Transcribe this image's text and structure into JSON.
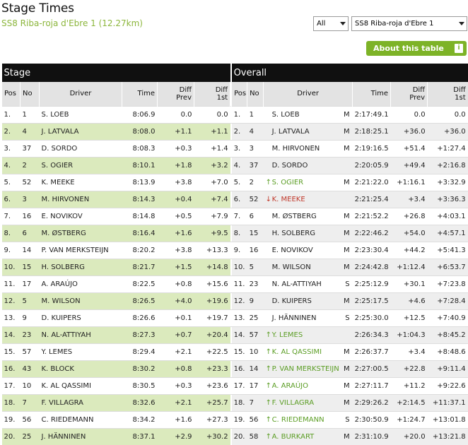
{
  "header": {
    "title": "Stage Times",
    "subtitle": "SS8 Riba-roja d'Ebre 1 (12.27km)",
    "filter_value": "All",
    "stage_select_value": "SS8 Riba-roja d'Ebre 1",
    "about_label": "About this table",
    "about_icon": "i"
  },
  "sections": {
    "stage": "Stage",
    "overall": "Overall"
  },
  "columns": {
    "stage": [
      "Pos",
      "No",
      "Driver",
      "Time",
      "Diff Prev",
      "Diff 1st"
    ],
    "overall": [
      "Pos",
      "No",
      "Driver",
      "Time",
      "Diff Prev",
      "Diff 1st"
    ]
  },
  "colors": {
    "green": "#7db327",
    "row_alt": "#dbeabd",
    "up": "#5b9d24",
    "down": "#c0392b"
  },
  "stage_rows": [
    [
      "1.",
      "1",
      "S. LOEB",
      "8:06.9",
      "0.0",
      "0.0"
    ],
    [
      "2.",
      "4",
      "J. LATVALA",
      "8:08.0",
      "+1.1",
      "+1.1"
    ],
    [
      "3.",
      "37",
      "D. SORDO",
      "8:08.3",
      "+0.3",
      "+1.4"
    ],
    [
      "4.",
      "2",
      "S. OGIER",
      "8:10.1",
      "+1.8",
      "+3.2"
    ],
    [
      "5.",
      "52",
      "K. MEEKE",
      "8:13.9",
      "+3.8",
      "+7.0"
    ],
    [
      "6.",
      "3",
      "M. HIRVONEN",
      "8:14.3",
      "+0.4",
      "+7.4"
    ],
    [
      "7.",
      "16",
      "E. NOVIKOV",
      "8:14.8",
      "+0.5",
      "+7.9"
    ],
    [
      "8.",
      "6",
      "M. ØSTBERG",
      "8:16.4",
      "+1.6",
      "+9.5"
    ],
    [
      "9.",
      "14",
      "P. VAN MERKSTEIJN",
      "8:20.2",
      "+3.8",
      "+13.3"
    ],
    [
      "10.",
      "15",
      "H. SOLBERG",
      "8:21.7",
      "+1.5",
      "+14.8"
    ],
    [
      "11.",
      "17",
      "A. ARAÚJO",
      "8:22.5",
      "+0.8",
      "+15.6"
    ],
    [
      "12.",
      "5",
      "M. WILSON",
      "8:26.5",
      "+4.0",
      "+19.6"
    ],
    [
      "13.",
      "9",
      "D. KUIPERS",
      "8:26.6",
      "+0.1",
      "+19.7"
    ],
    [
      "14.",
      "23",
      "N. AL-ATTIYAH",
      "8:27.3",
      "+0.7",
      "+20.4"
    ],
    [
      "15.",
      "57",
      "Y. LEMES",
      "8:29.4",
      "+2.1",
      "+22.5"
    ],
    [
      "16.",
      "43",
      "K. BLOCK",
      "8:30.2",
      "+0.8",
      "+23.3"
    ],
    [
      "17.",
      "10",
      "K. AL QASSIMI",
      "8:30.5",
      "+0.3",
      "+23.6"
    ],
    [
      "18.",
      "7",
      "F. VILLAGRA",
      "8:32.6",
      "+2.1",
      "+25.7"
    ],
    [
      "19.",
      "56",
      "C. RIEDEMANN",
      "8:34.2",
      "+1.6",
      "+27.3"
    ],
    [
      "20.",
      "25",
      "J. HÄNNINEN",
      "8:37.1",
      "+2.9",
      "+30.2"
    ]
  ],
  "overall_rows": [
    [
      "1.",
      "1",
      "",
      "S. LOEB",
      "M",
      "2:17:49.1",
      "0.0",
      "0.0"
    ],
    [
      "2.",
      "4",
      "",
      "J. LATVALA",
      "M",
      "2:18:25.1",
      "+36.0",
      "+36.0"
    ],
    [
      "3.",
      "3",
      "",
      "M. HIRVONEN",
      "M",
      "2:19:16.5",
      "+51.4",
      "+1:27.4"
    ],
    [
      "4.",
      "37",
      "",
      "D. SORDO",
      "",
      "2:20:05.9",
      "+49.4",
      "+2:16.8"
    ],
    [
      "5.",
      "2",
      "up",
      "S. OGIER",
      "M",
      "2:21:22.0",
      "+1:16.1",
      "+3:32.9"
    ],
    [
      "6.",
      "52",
      "down",
      "K. MEEKE",
      "",
      "2:21:25.4",
      "+3.4",
      "+3:36.3"
    ],
    [
      "7.",
      "6",
      "",
      "M. ØSTBERG",
      "M",
      "2:21:52.2",
      "+26.8",
      "+4:03.1"
    ],
    [
      "8.",
      "15",
      "",
      "H. SOLBERG",
      "M",
      "2:22:46.2",
      "+54.0",
      "+4:57.1"
    ],
    [
      "9.",
      "16",
      "",
      "E. NOVIKOV",
      "M",
      "2:23:30.4",
      "+44.2",
      "+5:41.3"
    ],
    [
      "10.",
      "5",
      "",
      "M. WILSON",
      "M",
      "2:24:42.8",
      "+1:12.4",
      "+6:53.7"
    ],
    [
      "11.",
      "23",
      "",
      "N. AL-ATTIYAH",
      "S",
      "2:25:12.9",
      "+30.1",
      "+7:23.8"
    ],
    [
      "12.",
      "9",
      "",
      "D. KUIPERS",
      "M",
      "2:25:17.5",
      "+4.6",
      "+7:28.4"
    ],
    [
      "13.",
      "25",
      "",
      "J. HÄNNINEN",
      "S",
      "2:25:30.0",
      "+12.5",
      "+7:40.9"
    ],
    [
      "14.",
      "57",
      "up",
      "Y. LEMES",
      "",
      "2:26:34.3",
      "+1:04.3",
      "+8:45.2"
    ],
    [
      "15.",
      "10",
      "up",
      "K. AL QASSIMI",
      "M",
      "2:26:37.7",
      "+3.4",
      "+8:48.6"
    ],
    [
      "16.",
      "14",
      "up",
      "P. VAN MERKSTEIJN",
      "M",
      "2:27:00.5",
      "+22.8",
      "+9:11.4"
    ],
    [
      "17.",
      "17",
      "up",
      "A. ARAÚJO",
      "M",
      "2:27:11.7",
      "+11.2",
      "+9:22.6"
    ],
    [
      "18.",
      "7",
      "up",
      "F. VILLAGRA",
      "M",
      "2:29:26.2",
      "+2:14.5",
      "+11:37.1"
    ],
    [
      "19.",
      "56",
      "up",
      "C. RIEDEMANN",
      "S",
      "2:30:50.9",
      "+1:24.7",
      "+13:01.8"
    ],
    [
      "20.",
      "58",
      "up",
      "A. BURKART",
      "M",
      "2:31:10.9",
      "+20.0",
      "+13:21.8"
    ]
  ]
}
